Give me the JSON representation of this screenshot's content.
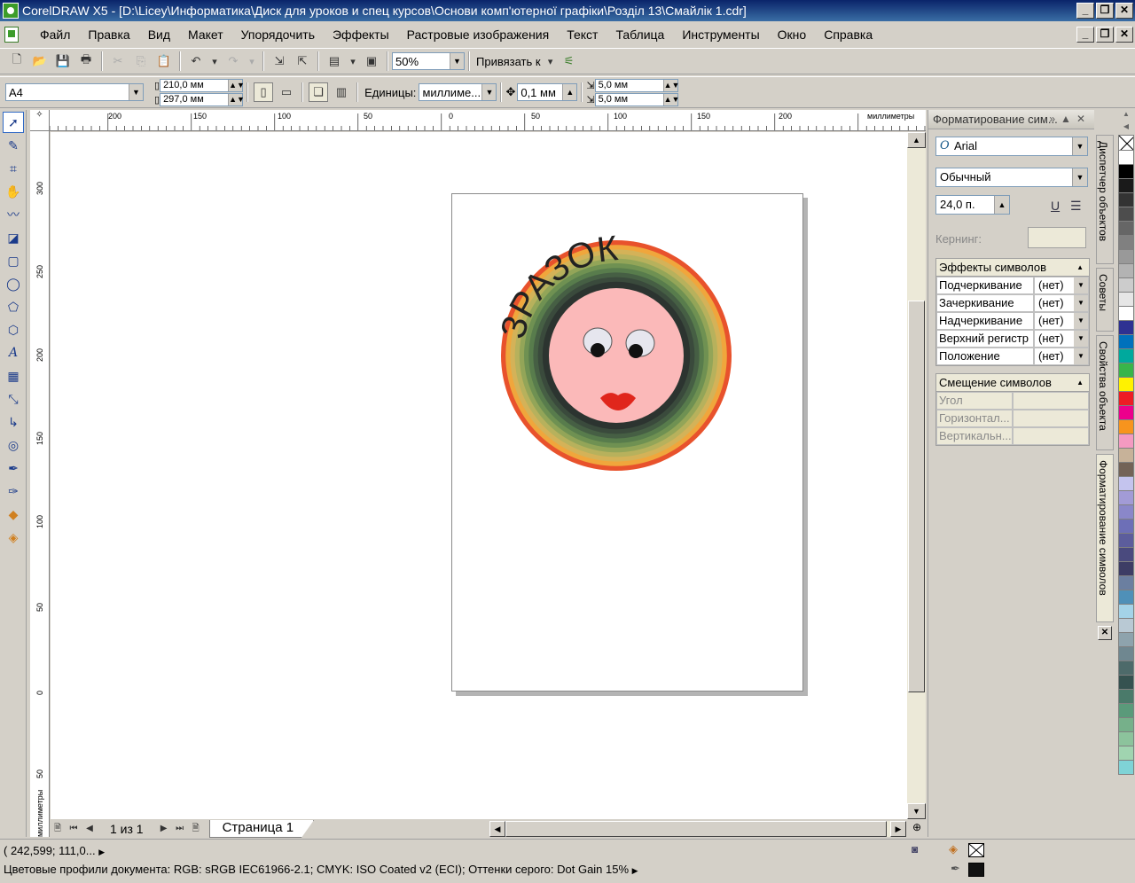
{
  "window": {
    "title": "CorelDRAW X5 - [D:\\Licey\\Информатика\\Диск для уроков и спец курсов\\Основи комп'ютерної графіки\\Розділ 13\\Смайлік 1.cdr]"
  },
  "menu": [
    "Файл",
    "Правка",
    "Вид",
    "Макет",
    "Упорядочить",
    "Эффекты",
    "Растровые изображения",
    "Текст",
    "Таблица",
    "Инструменты",
    "Окно",
    "Справка"
  ],
  "toolbar": {
    "zoom": "50%",
    "snap_label": "Привязать к"
  },
  "propbar": {
    "page_size": "A4",
    "width": "210,0 мм",
    "height": "297,0 мм",
    "units_label": "Единицы:",
    "units_value": "миллиме...",
    "nudge": "0,1 мм",
    "dup_x": "5,0 мм",
    "dup_y": "5,0 мм"
  },
  "rulers": {
    "unit": "миллиметры",
    "h_ticks": [
      "200",
      "150",
      "100",
      "50",
      "0",
      "50",
      "100",
      "150",
      "200"
    ],
    "v_ticks": [
      "300",
      "250",
      "200",
      "150",
      "100",
      "50",
      "0",
      "50"
    ]
  },
  "drawing": {
    "sample_text": "ЗРАЗОК",
    "ring_colors": [
      "#e8522c",
      "#f0a63c",
      "#d4b258",
      "#b7b15c",
      "#93a558",
      "#6f9152",
      "#587c4c",
      "#465f44",
      "#3a4a3c",
      "#2c3430"
    ],
    "face_color": "#fbb9b9",
    "lips_color": "#e0261c"
  },
  "pagenav": {
    "count": "1 из 1",
    "tab": "Страница 1"
  },
  "docker": {
    "title": "Форматирование сим...",
    "font": "Arial",
    "style": "Обычный",
    "size": "24,0 п.",
    "kerning_label": "Кернинг:",
    "effects_title": "Эффекты символов",
    "effects": [
      {
        "label": "Подчеркивание",
        "value": "(нет)"
      },
      {
        "label": "Зачеркивание",
        "value": "(нет)"
      },
      {
        "label": "Надчеркивание",
        "value": "(нет)"
      },
      {
        "label": "Верхний регистр",
        "value": "(нет)"
      },
      {
        "label": "Положение",
        "value": "(нет)"
      }
    ],
    "shift_title": "Смещение символов",
    "shift": [
      {
        "label": "Угол"
      },
      {
        "label": "Горизонтал..."
      },
      {
        "label": "Вертикальн..."
      }
    ]
  },
  "vtabs": [
    "Диспетчер объектов",
    "Советы",
    "Свойства объекта",
    "Форматирование символов"
  ],
  "palette": [
    "#ffffff",
    "#000000",
    "#1a1a1a",
    "#333333",
    "#4d4d4d",
    "#666666",
    "#808080",
    "#999999",
    "#b3b3b3",
    "#cccccc",
    "#e6e6e6",
    "#ffffff",
    "#2e3192",
    "#0071bc",
    "#00a99d",
    "#39b54a",
    "#fff200",
    "#ed1c24",
    "#ec008c",
    "#f7941d",
    "#f49ac1",
    "#c7b299",
    "#736357",
    "#c4c4ee",
    "#a29bd6",
    "#8a87c9",
    "#6d6fb7",
    "#5c5d9c",
    "#4a4a7e",
    "#3d3d65",
    "#6b7fa0",
    "#4f90b8",
    "#a4d3e8",
    "#b9c9d4",
    "#8ea3ad",
    "#6f8790",
    "#4d6a6a",
    "#355250",
    "#4a7a6a",
    "#5a9a7a",
    "#76b08a",
    "#8cc39c",
    "#a0d4b0",
    "#7fd3d6"
  ],
  "status": {
    "coords": "( 242,599; 111,0...",
    "profiles": "Цветовые профили документа: RGB: sRGB IEC61966-2.1; CMYK: ISO Coated v2 (ECI); Оттенки серого: Dot Gain 15%"
  }
}
